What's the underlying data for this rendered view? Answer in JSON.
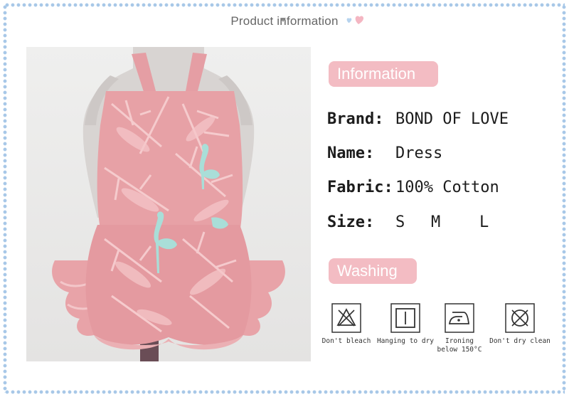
{
  "header": {
    "title": "Product information"
  },
  "information": {
    "heading": "Information",
    "brand_label": "Brand:",
    "brand_value": "BOND OF LOVE",
    "name_label": "Name:",
    "name_value": "Dress",
    "fabric_label": "Fabric:",
    "fabric_value": "100% Cotton",
    "size_label": "Size:",
    "sizes": [
      "S",
      "M",
      "L"
    ]
  },
  "washing": {
    "heading": "Washing",
    "items": [
      {
        "icon": "no-bleach-icon",
        "label": "Don't bleach"
      },
      {
        "icon": "hang-dry-icon",
        "label": "Hanging to dry"
      },
      {
        "icon": "iron-icon",
        "label_line1": "Ironing",
        "label_line2": "below 150°C"
      },
      {
        "icon": "no-dry-clean-icon",
        "label": "Don't dry clean"
      }
    ]
  },
  "colors": {
    "accent_pill": "#f3bcc3",
    "border_dots": "#a8c8e8",
    "dress_pink": "#e7a1a6"
  }
}
